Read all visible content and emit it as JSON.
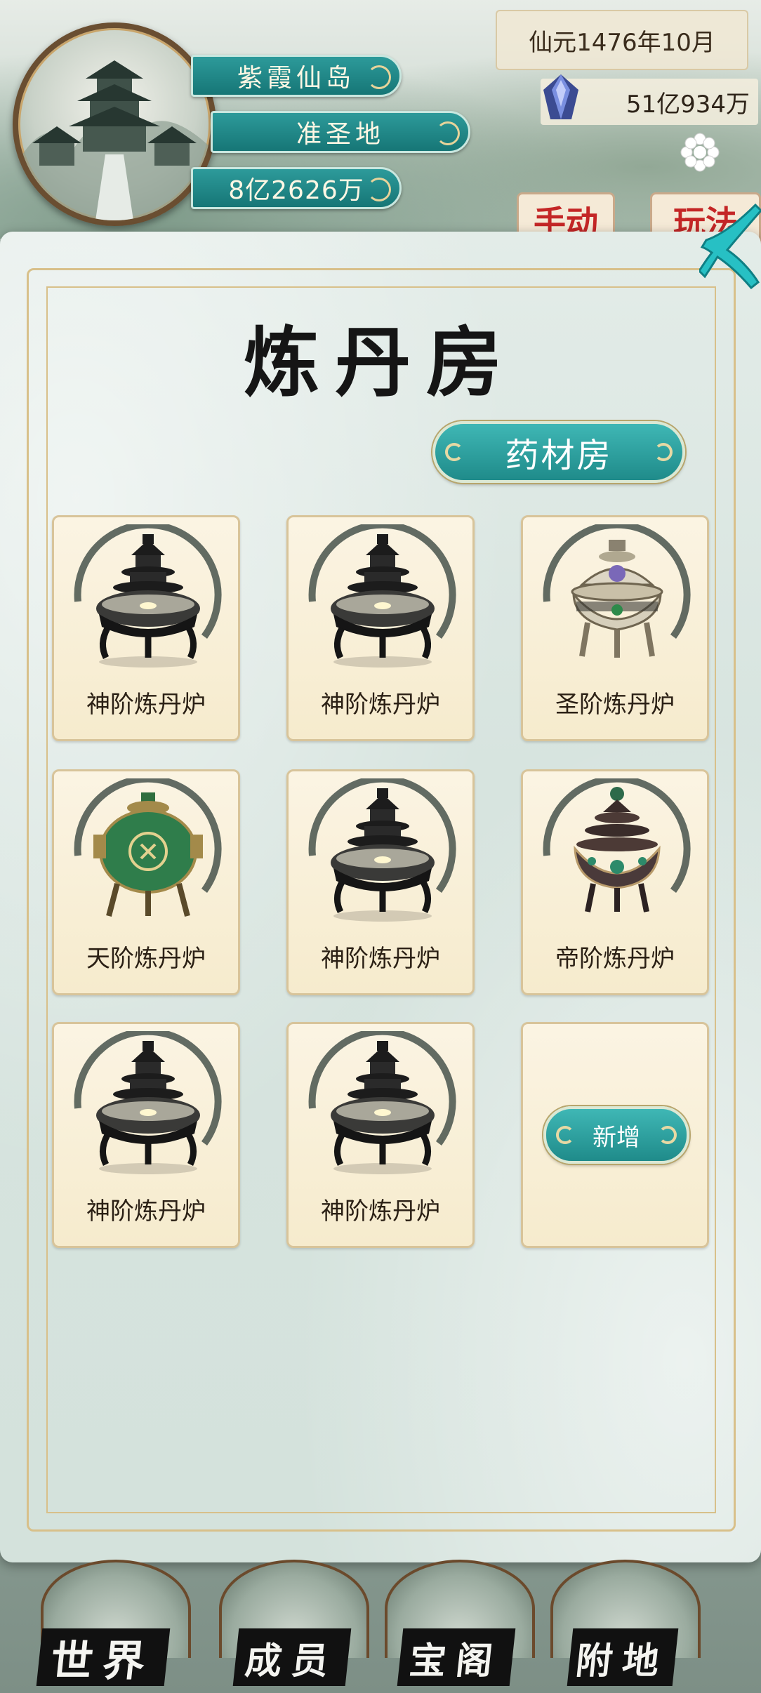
{
  "header": {
    "sect_name": "紫霞仙岛",
    "sect_rank": "准圣地",
    "sect_power": "8亿2626万",
    "date": "仙元1476年10月",
    "spirit_stones": "51亿934万",
    "manual_button": "手动",
    "play_button": "玩法"
  },
  "panel": {
    "title": "炼丹房",
    "herb_room_button": "药材房",
    "furnaces": [
      {
        "label": "神阶炼丹炉",
        "variant": "black-tiered"
      },
      {
        "label": "神阶炼丹炉",
        "variant": "black-tiered"
      },
      {
        "label": "圣阶炼丹炉",
        "variant": "silver-lidded"
      },
      {
        "label": "天阶炼丹炉",
        "variant": "green-jade"
      },
      {
        "label": "神阶炼丹炉",
        "variant": "black-tiered"
      },
      {
        "label": "帝阶炼丹炉",
        "variant": "bronze-pagoda"
      },
      {
        "label": "神阶炼丹炉",
        "variant": "black-tiered"
      },
      {
        "label": "神阶炼丹炉",
        "variant": "black-tiered"
      }
    ],
    "add_button": "新增"
  },
  "bottom_nav": {
    "items": [
      {
        "label": "世界"
      },
      {
        "label": "成员"
      },
      {
        "label": "宝阁"
      },
      {
        "label": "附地"
      }
    ]
  },
  "colors": {
    "teal_button": "#1f8b8a",
    "card_bg": "#f6ebcd",
    "frame_gold": "#d8c08a",
    "close_teal": "#27c0c4"
  }
}
